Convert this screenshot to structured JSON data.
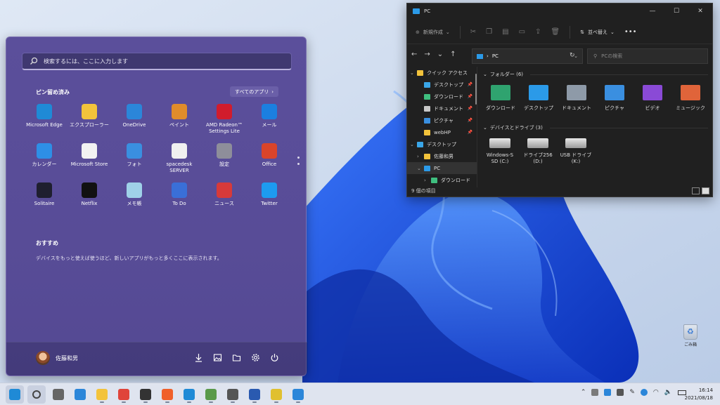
{
  "start_menu": {
    "search_placeholder": "検索するには、ここに入力します",
    "pinned_title": "ピン留め済み",
    "all_apps_label": "すべてのアプリ",
    "pinned_apps": [
      {
        "label": "Microsoft Edge",
        "color": "#1f8ad6"
      },
      {
        "label": "エクスプローラー",
        "color": "#f3c33b"
      },
      {
        "label": "OneDrive",
        "color": "#2b86d9"
      },
      {
        "label": "ペイント",
        "color": "#e08c2b"
      },
      {
        "label": "AMD Radeon™ Settings Lite",
        "color": "#d11c2c"
      },
      {
        "label": "メール",
        "color": "#1b7fe0"
      },
      {
        "label": "カレンダー",
        "color": "#2e8fe6"
      },
      {
        "label": "Microsoft Store",
        "color": "#f2f2f2"
      },
      {
        "label": "フォト",
        "color": "#3a8fe0"
      },
      {
        "label": "spacedesk SERVER",
        "color": "#f0f0f0"
      },
      {
        "label": "設定",
        "color": "#8e8e9a"
      },
      {
        "label": "Office",
        "color": "#d9442a"
      },
      {
        "label": "Solitaire",
        "color": "#1f1f2f"
      },
      {
        "label": "Netflix",
        "color": "#111111"
      },
      {
        "label": "メモ帳",
        "color": "#9fd1e8"
      },
      {
        "label": "To Do",
        "color": "#3a6fd8"
      },
      {
        "label": "ニュース",
        "color": "#d73a3a"
      },
      {
        "label": "Twitter",
        "color": "#1d9bf0"
      }
    ],
    "recommended_title": "おすすめ",
    "recommended_desc": "デバイスをもっと使えば使うほど、新しいアプリがもっと多くここに表示されます。",
    "user_name": "佐藤和男"
  },
  "explorer": {
    "title": "PC",
    "new_label": "新規作成",
    "sort_label": "並べ替え",
    "address": "PC",
    "search_placeholder": "PCの検索",
    "nav": [
      {
        "label": "クイック アクセス",
        "arrow": "⌄",
        "color": "#f3c33b",
        "indent": 0,
        "pin": ""
      },
      {
        "label": "デスクトップ",
        "arrow": "",
        "color": "#3aa6e8",
        "indent": 1,
        "pin": "📌"
      },
      {
        "label": "ダウンロード",
        "arrow": "",
        "color": "#3fbf7f",
        "indent": 1,
        "pin": "📌"
      },
      {
        "label": "ドキュメント",
        "arrow": "",
        "color": "#c8c8c8",
        "indent": 1,
        "pin": "📌"
      },
      {
        "label": "ピクチャ",
        "arrow": "",
        "color": "#3a8fe0",
        "indent": 1,
        "pin": "📌"
      },
      {
        "label": "webHP",
        "arrow": "",
        "color": "#f3c33b",
        "indent": 1,
        "pin": "📌"
      },
      {
        "label": "デスクトップ",
        "arrow": "⌄",
        "color": "#3aa6e8",
        "indent": 0,
        "pin": ""
      },
      {
        "label": "佐藤和男",
        "arrow": "›",
        "color": "#f3c33b",
        "indent": 1,
        "pin": ""
      },
      {
        "label": "PC",
        "arrow": "⌄",
        "color": "#2b9ae8",
        "indent": 1,
        "pin": ""
      },
      {
        "label": "ダウンロード",
        "arrow": "›",
        "color": "#3fbf7f",
        "indent": 2,
        "pin": ""
      }
    ],
    "folders_header": "フォルダー (6)",
    "folders": [
      {
        "label": "ダウンロード",
        "color": "#2fa36f"
      },
      {
        "label": "デスクトップ",
        "color": "#2b9ae8"
      },
      {
        "label": "ドキュメント",
        "color": "#8e9aa8"
      },
      {
        "label": "ピクチャ",
        "color": "#3a8fe0"
      },
      {
        "label": "ビデオ",
        "color": "#8a4ad6"
      },
      {
        "label": "ミュージック",
        "color": "#e0643a"
      }
    ],
    "drives_header": "デバイスとドライブ (3)",
    "drives": [
      {
        "line1": "Windows-S",
        "line2": "SD (C:)"
      },
      {
        "line1": "ドライブ256",
        "line2": "(D:)"
      },
      {
        "line1": "USB ドライブ",
        "line2": "(K:)"
      }
    ],
    "status": "9 個の項目"
  },
  "desktop": {
    "recycle_bin_label": "ごみ箱"
  },
  "taskbar": {
    "apps": [
      {
        "name": "start",
        "color": "#1f8ad6"
      },
      {
        "name": "search",
        "color": "#444"
      },
      {
        "name": "task-view",
        "color": "#666"
      },
      {
        "name": "widgets",
        "color": "#2b86d9"
      },
      {
        "name": "explorer",
        "color": "#f3c33b"
      },
      {
        "name": "chrome",
        "color": "#e0443a"
      },
      {
        "name": "calculator",
        "color": "#333"
      },
      {
        "name": "brave",
        "color": "#f0602a"
      },
      {
        "name": "edge",
        "color": "#1f8ad6"
      },
      {
        "name": "remote",
        "color": "#5a9a4a"
      },
      {
        "name": "network",
        "color": "#555"
      },
      {
        "name": "media",
        "color": "#2a5ab0"
      },
      {
        "name": "notepad",
        "color": "#e0c030"
      },
      {
        "name": "onedrive",
        "color": "#2b86d9"
      }
    ],
    "time": "16:14",
    "date": "2021/08/18"
  }
}
